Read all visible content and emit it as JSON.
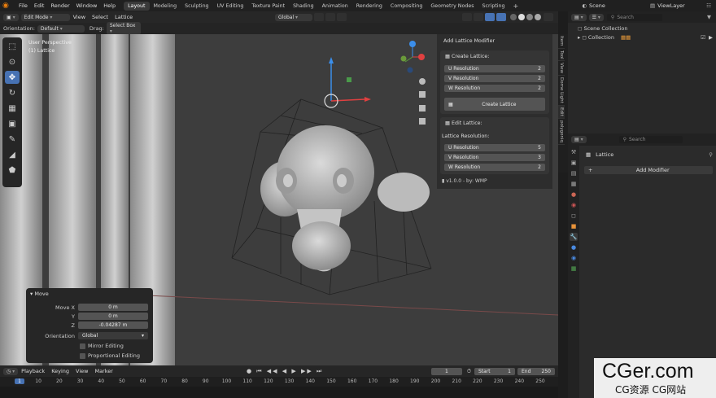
{
  "top_menu": [
    "File",
    "Edit",
    "Render",
    "Window",
    "Help"
  ],
  "workspaces": [
    "Layout",
    "Modeling",
    "Sculpting",
    "UV Editing",
    "Texture Paint",
    "Shading",
    "Animation",
    "Rendering",
    "Compositing",
    "Geometry Nodes",
    "Scripting"
  ],
  "active_workspace": "Layout",
  "scene_name": "Scene",
  "view_layer": "ViewLayer",
  "header": {
    "mode": "Edit Mode",
    "menus": [
      "View",
      "Select",
      "Lattice"
    ],
    "transform": "Global"
  },
  "toolbar": {
    "orientation_label": "Orientation:",
    "orientation_value": "Default",
    "drag_label": "Drag:",
    "drag_value": "Select Box"
  },
  "viewport": {
    "perspective": "User Perspective",
    "object": "(1) Lattice"
  },
  "addon_panel": {
    "title": "Add Lattice Modifier",
    "create_title": "Create Lattice:",
    "create_rows": [
      {
        "label": "U Resolution",
        "value": "2"
      },
      {
        "label": "V Resolution",
        "value": "2"
      },
      {
        "label": "W Resolution",
        "value": "2"
      }
    ],
    "create_button": "Create Lattice",
    "edit_title": "Edit Lattice:",
    "res_label": "Lattice Resolution:",
    "edit_rows": [
      {
        "label": "U Resolution",
        "value": "5"
      },
      {
        "label": "V Resolution",
        "value": "3"
      },
      {
        "label": "W Resolution",
        "value": "2"
      }
    ],
    "version": "v1.0.0 - by: WMP"
  },
  "n_tabs": [
    "Item",
    "Tool",
    "View",
    "Dome Light",
    "Edit",
    "polygoniq"
  ],
  "move_panel": {
    "title": "Move",
    "move_x_label": "Move X",
    "move_x": "0 m",
    "y_label": "Y",
    "y": "0 m",
    "z_label": "Z",
    "z": "-0.04287 m",
    "orientation_label": "Orientation",
    "orientation": "Global",
    "mirror": "Mirror Editing",
    "proportional": "Proportional Editing"
  },
  "timeline": {
    "menus": [
      "Playback",
      "Keying",
      "View",
      "Marker"
    ],
    "current_frame": "1",
    "start_label": "Start",
    "start": "1",
    "end_label": "End",
    "end": "250",
    "ticks": [
      "1",
      "10",
      "20",
      "30",
      "40",
      "50",
      "60",
      "70",
      "80",
      "90",
      "100",
      "110",
      "120",
      "130",
      "140",
      "150",
      "160",
      "170",
      "180",
      "190",
      "200",
      "210",
      "220",
      "230",
      "240",
      "250"
    ]
  },
  "outliner": {
    "search_placeholder": "Search",
    "scene_collection": "Scene Collection",
    "collection": "Collection"
  },
  "properties": {
    "search_placeholder": "Search",
    "object": "Lattice",
    "add_modifier": "Add Modifier"
  },
  "watermark": {
    "logo": "CGer.com",
    "sub": "CG资源 CG网站"
  }
}
